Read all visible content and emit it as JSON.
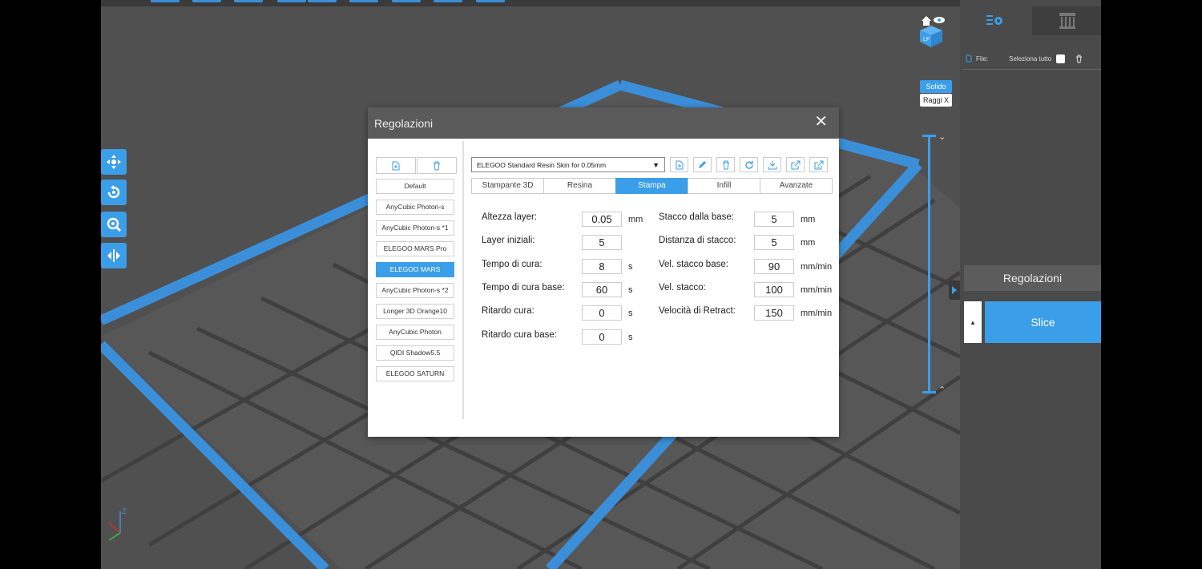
{
  "viewport": {
    "modes": {
      "solid": "Solido",
      "xray": "Raggi X"
    },
    "viewcube_letters": "LF"
  },
  "right_panel": {
    "files_label": "File:",
    "select_all_label": "Seleziona tutto",
    "adjustments_button": "Regolazioni",
    "slice_button": "Slice"
  },
  "dialog": {
    "title": "Regolazioni",
    "profiles": [
      "Default",
      "AnyCubic Photon-s",
      "AnyCubic Photon-s *1",
      "ELEGOO MARS Pro",
      "ELEGOO MARS",
      "AnyCubic Photon-s *2",
      "Longer 3D Orange10",
      "AnyCubic Photon",
      "QIDI Shadow5.5",
      "ELEGOO SATURN"
    ],
    "selected_profile": "ELEGOO MARS",
    "resin_profile": "ELEGOO Standard Resin Skin for 0.05mm",
    "tabs": [
      "Stampante 3D",
      "Resina",
      "Stampa",
      "Infill",
      "Avanzate"
    ],
    "active_tab": "Stampa",
    "left_params": [
      {
        "label": "Altezza layer:",
        "value": "0.05",
        "unit": "mm"
      },
      {
        "label": "Layer iniziali:",
        "value": "5",
        "unit": ""
      },
      {
        "label": "Tempo di cura:",
        "value": "8",
        "unit": "s"
      },
      {
        "label": "Tempo di cura base:",
        "value": "60",
        "unit": "s"
      },
      {
        "label": "Ritardo cura:",
        "value": "0",
        "unit": "s"
      },
      {
        "label": "Ritardo cura base:",
        "value": "0",
        "unit": "s"
      }
    ],
    "right_params": [
      {
        "label": "Stacco dalla base:",
        "value": "5",
        "unit": "mm"
      },
      {
        "label": "Distanza di stacco:",
        "value": "5",
        "unit": "mm"
      },
      {
        "label": "Vel. stacco base:",
        "value": "90",
        "unit": "mm/min"
      },
      {
        "label": "Vel. stacco:",
        "value": "100",
        "unit": "mm/min"
      },
      {
        "label": "Velocità di Retract:",
        "value": "150",
        "unit": "mm/min"
      }
    ]
  },
  "colors": {
    "accent": "#3b9ee8",
    "panel": "#4a4a4a",
    "viewport": "#505050",
    "dialog_header": "#5a5a5a"
  }
}
